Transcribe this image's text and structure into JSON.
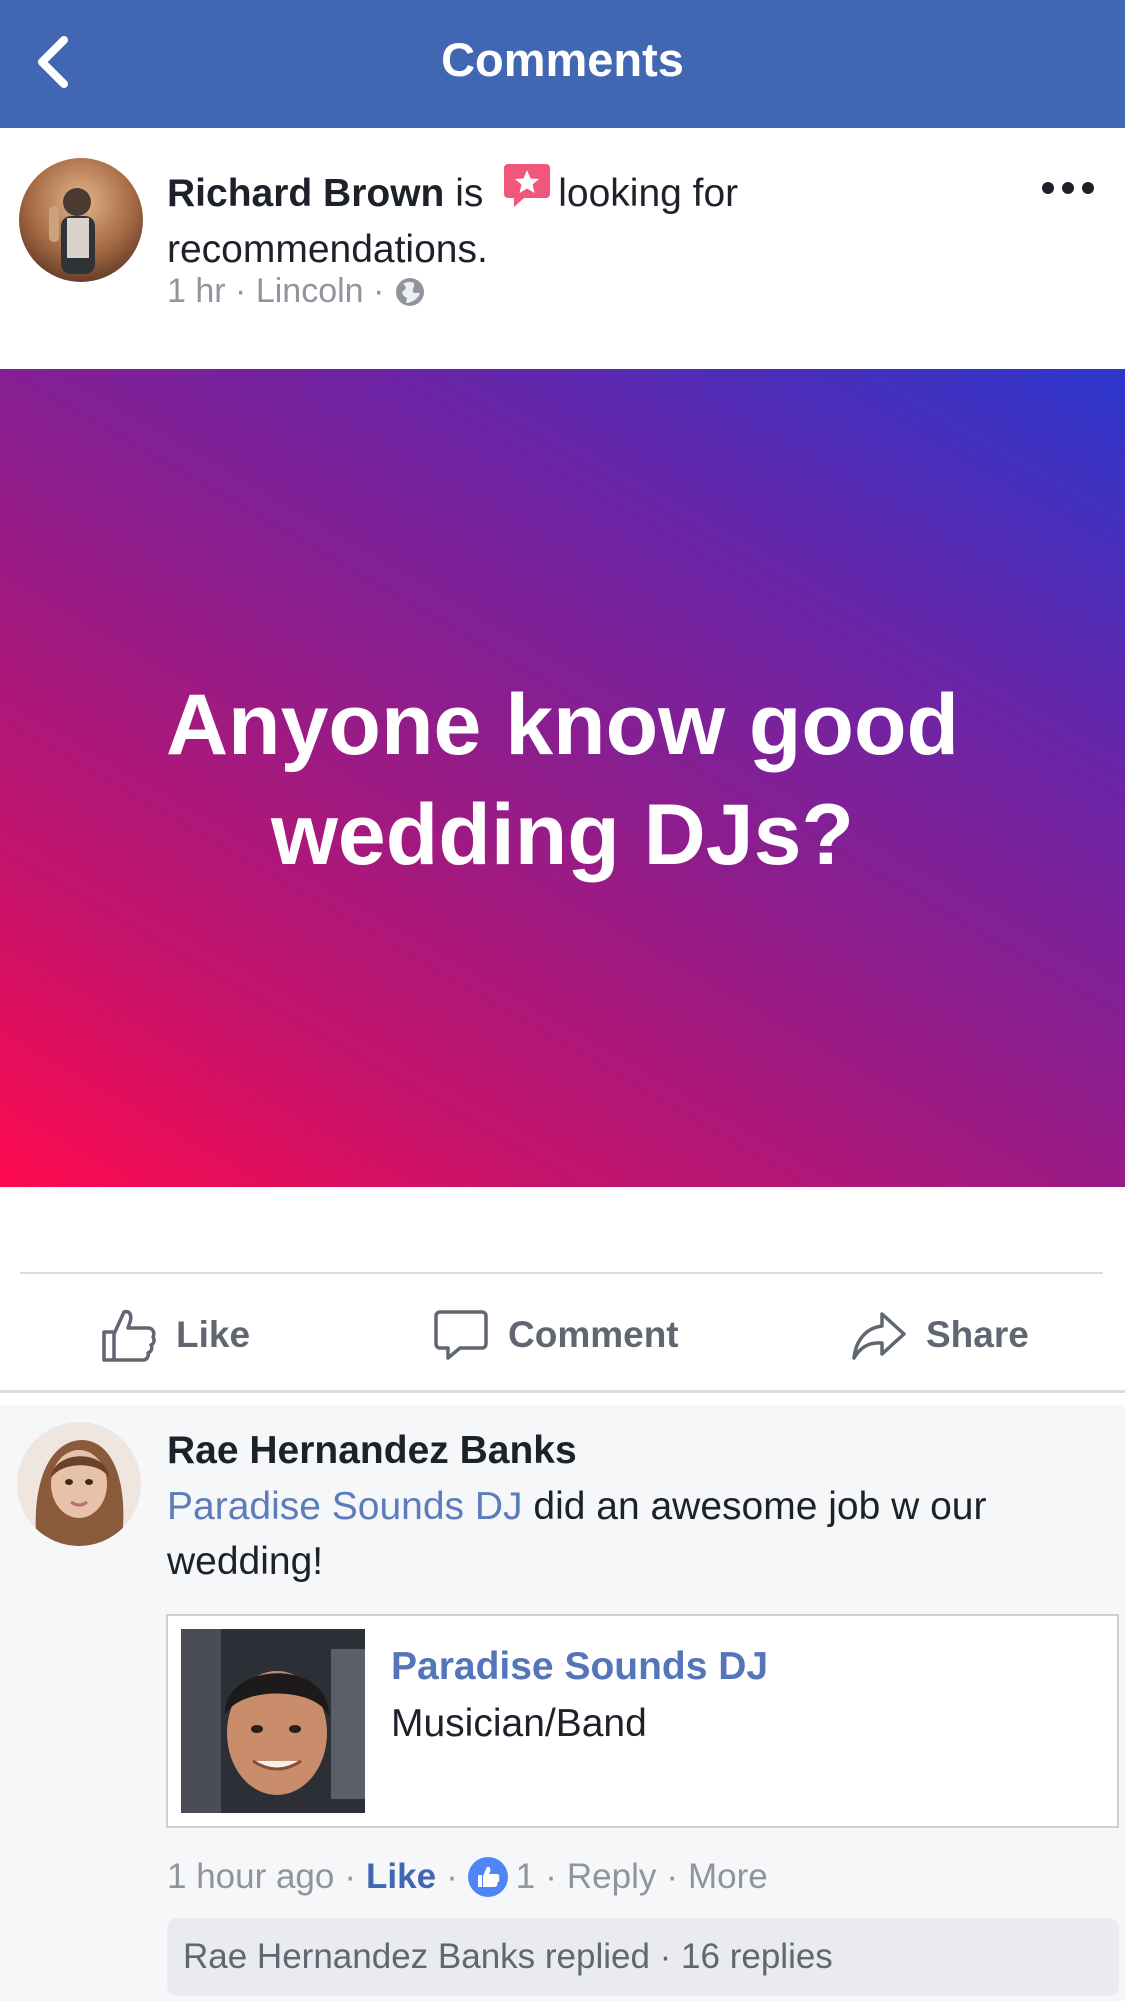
{
  "header": {
    "title": "Comments",
    "back_icon": "chevron-left-icon",
    "background": "#4267b2"
  },
  "post": {
    "author": "Richard Brown",
    "verb": "is",
    "activity_icon": "recommendation-star-icon",
    "activity": "looking for recommendations.",
    "time": "1 hr",
    "location": "Lincoln",
    "privacy_icon": "globe-icon",
    "more_icon": "more-dots-icon",
    "card_text": "Anyone know good wedding DJs?",
    "gradient_colors": [
      "#ff0a4f",
      "#8e1d8c",
      "#2b36cc"
    ]
  },
  "actions": {
    "like_label": "Like",
    "comment_label": "Comment",
    "share_label": "Share"
  },
  "comment": {
    "author": "Rae Hernandez Banks",
    "mention": "Paradise Sounds DJ",
    "text": " did an awesome job w our wedding!",
    "page_card": {
      "name": "Paradise Sounds DJ",
      "category": "Musician/Band"
    },
    "meta": {
      "time": "1 hour ago",
      "like_label": "Like",
      "reaction_count": "1",
      "reply_label": "Reply",
      "more_label": "More"
    },
    "replies_summary": "Rae Hernandez Banks replied · 16 replies"
  }
}
